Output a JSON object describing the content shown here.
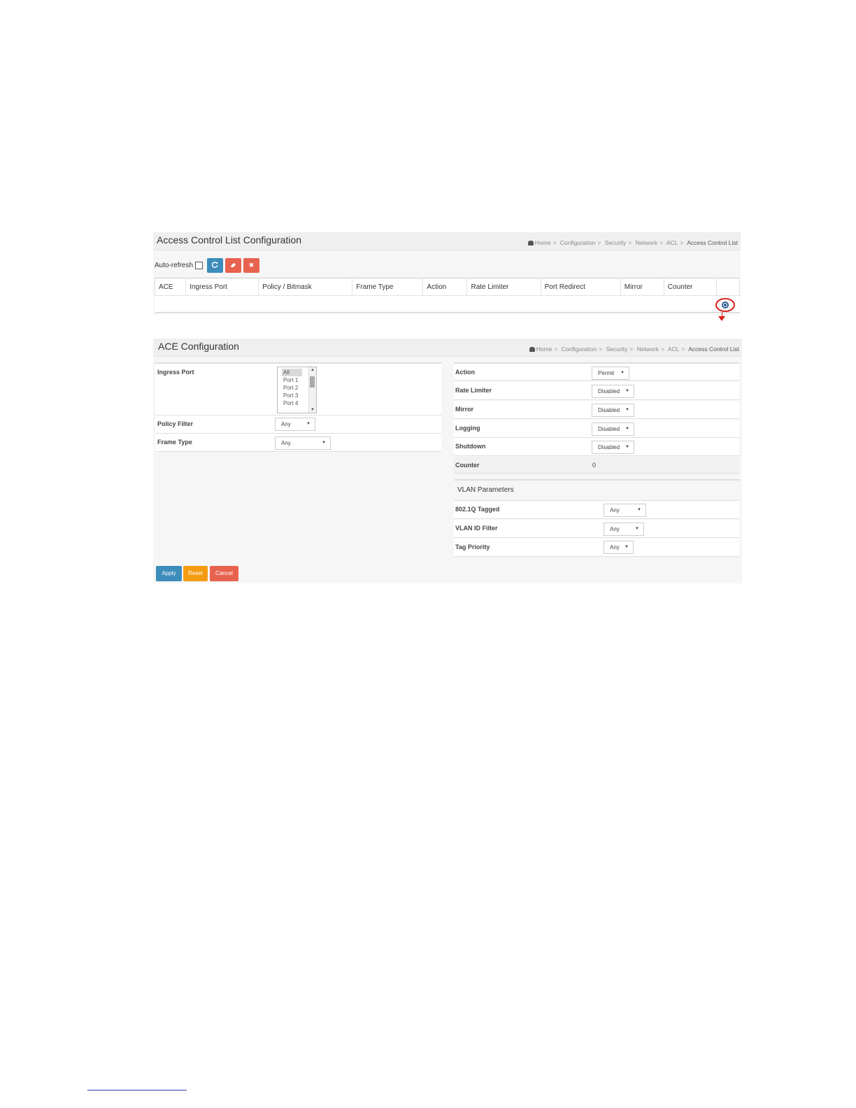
{
  "breadcrumb": {
    "home": "Home",
    "items": [
      "Configuration",
      "Security",
      "Network",
      "ACL"
    ],
    "current": "Access Control List"
  },
  "acl": {
    "title": "Access Control List Configuration",
    "auto_refresh_label": "Auto-refresh",
    "auto_refresh_checked": false,
    "buttons": {
      "refresh_icon": "refresh-icon",
      "clear_icon": "eraser-icon",
      "delete_icon": "times-icon"
    },
    "columns": [
      "ACE",
      "Ingress Port",
      "Policy / Bitmask",
      "Frame Type",
      "Action",
      "Rate Limiter",
      "Port Redirect",
      "Mirror",
      "Counter"
    ],
    "rows": [],
    "add_icon": "plus-circle-icon",
    "annotation_color": "#d9221b"
  },
  "ace": {
    "title": "ACE Configuration",
    "left": {
      "ingress_port_label": "Ingress Port",
      "ingress_port_options": [
        "All",
        "Port 1",
        "Port 2",
        "Port 3",
        "Port 4"
      ],
      "ingress_port_selected": "All",
      "policy_filter_label": "Policy Filter",
      "policy_filter_value": "Any",
      "frame_type_label": "Frame Type",
      "frame_type_value": "Any"
    },
    "right": {
      "action_label": "Action",
      "action_value": "Permit",
      "rate_limiter_label": "Rate Limiter",
      "rate_limiter_value": "Disabled",
      "mirror_label": "Mirror",
      "mirror_value": "Disabled",
      "logging_label": "Logging",
      "logging_value": "Disabled",
      "shutdown_label": "Shutdown",
      "shutdown_value": "Disabled",
      "counter_label": "Counter",
      "counter_value": "0"
    },
    "vlan": {
      "heading": "VLAN Parameters",
      "tagged_label": "802.1Q Tagged",
      "tagged_value": "Any",
      "vid_filter_label": "VLAN ID Filter",
      "vid_filter_value": "Any",
      "tag_priority_label": "Tag Priority",
      "tag_priority_value": "Any"
    },
    "buttons": {
      "apply": "Apply",
      "reset": "Reset",
      "cancel": "Cancel"
    }
  },
  "colors": {
    "primary": "#3c8dbc",
    "danger": "#e8634f",
    "warning": "#f39c12"
  }
}
